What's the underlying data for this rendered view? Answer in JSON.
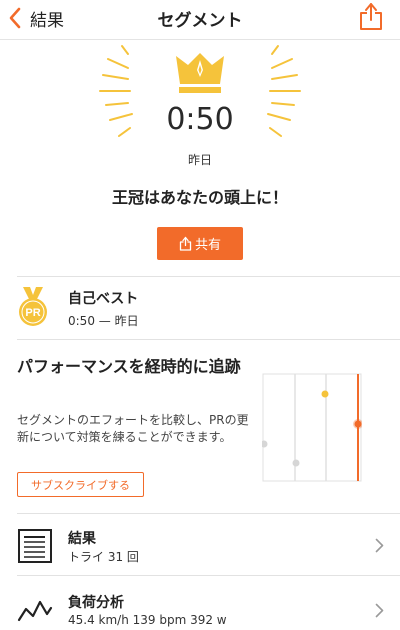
{
  "nav": {
    "back_label": "結果",
    "title": "セグメント"
  },
  "hero": {
    "time": "0:50",
    "date": "昨日",
    "headline": "王冠はあなたの頭上に！",
    "share_label": "共有"
  },
  "pr": {
    "medal_text": "PR",
    "title": "自己ベスト",
    "subtitle": "0:50 — 昨日"
  },
  "promo": {
    "title": "パフォーマンスを経時的に追跡",
    "body": "セグメントのエフォートを比較し、PRの更新について対策を練ることができます。",
    "button_label": "サブスクライブする"
  },
  "rows": [
    {
      "title": "結果",
      "subtitle": "トライ 31 回",
      "icon": "results-list-icon"
    },
    {
      "title": "負荷分析",
      "subtitle": "45.4 km/h 139 bpm 392 w",
      "icon": "power-graph-icon"
    }
  ],
  "colors": {
    "accent": "#f26b2a",
    "gold": "#f5c33b",
    "text": "#222222",
    "divider": "#e2e2e2"
  }
}
